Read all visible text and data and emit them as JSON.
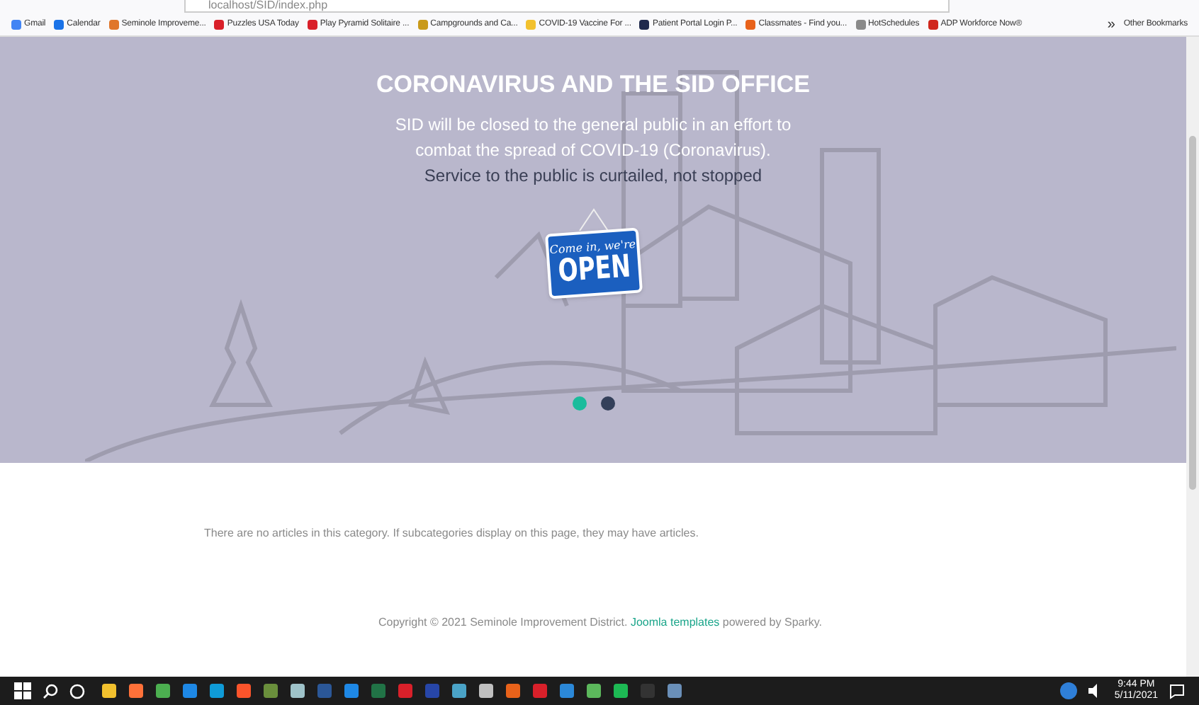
{
  "browser": {
    "url": "localhost/SID/index.php"
  },
  "bookmarks": [
    {
      "label": "Gmail",
      "color": "#4285f4"
    },
    {
      "label": "Calendar",
      "color": "#1a73e8"
    },
    {
      "label": "Seminole Improveme...",
      "color": "#e0762b"
    },
    {
      "label": "Puzzles USA Today",
      "color": "#d9202a"
    },
    {
      "label": "Play Pyramid Solitaire ...",
      "color": "#d9202a"
    },
    {
      "label": "Campgrounds and Ca...",
      "color": "#c99a1a"
    },
    {
      "label": "COVID-19 Vaccine For ...",
      "color": "#f2c12e"
    },
    {
      "label": "Patient Portal Login P...",
      "color": "#1f2a4d"
    },
    {
      "label": "Classmates - Find you...",
      "color": "#e8621a"
    },
    {
      "label": "HotSchedules",
      "color": "#8a8a8a"
    },
    {
      "label": "ADP Workforce Now®",
      "color": "#d0271d"
    }
  ],
  "bookmarks_more": "»",
  "other_bookmarks": "Other Bookmarks",
  "hero": {
    "title": "CORONAVIRUS AND THE SID OFFICE",
    "lines": [
      "SID will be closed to the general public in an effort to",
      "combat the spread of COVID-19 (Coronavirus)."
    ],
    "emphasis": "Service to the public is curtailed, not stopped",
    "sign": {
      "script": "Come in, we're",
      "word": "OPEN"
    },
    "dots": [
      {
        "selected": true
      },
      {
        "selected": false
      }
    ]
  },
  "notice": "There are no articles in this category. If subcategories display on this page, they may have articles.",
  "footer": {
    "before": "Copyright © 2021 Seminole Improvement District.",
    "link": "Joomla templates",
    "after": "powered by Sparky."
  },
  "taskbar": {
    "time": "9:44 PM",
    "date": "5/11/2021"
  }
}
